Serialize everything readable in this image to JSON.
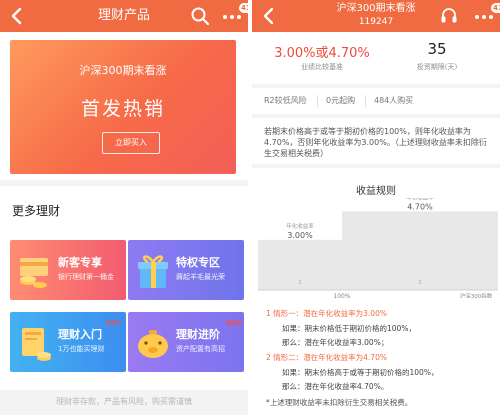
{
  "left": {
    "header": {
      "title": "理财产品",
      "badge": "41"
    },
    "banner": {
      "subtitle": "沪深300期末看涨",
      "headline": "首发热销",
      "button": "立即买入"
    },
    "section_title": "更多理财",
    "cards": [
      {
        "name": "新客专享",
        "desc": "银行理财第一桶金",
        "tag": ""
      },
      {
        "name": "特权专区",
        "desc": "薅起羊毛最光荣",
        "tag": ""
      },
      {
        "name": "理财入门",
        "desc": "1万也能买理财",
        "tag": "HOT"
      },
      {
        "name": "理财进阶",
        "desc": "资产配置有高招",
        "tag": "NEW"
      }
    ],
    "footer": "理财非存款，产品有风险，购买需谨慎"
  },
  "right": {
    "header": {
      "title": "沪深300期末看涨",
      "code": "119247",
      "badge": "41"
    },
    "stats": {
      "rate": "3.00%或4.70%",
      "rate_label": "业绩比较基准",
      "term": "35",
      "term_label": "投资期限(天)"
    },
    "tags": [
      "R2较低风险",
      "0元起购",
      "484人购买"
    ],
    "description": "若期末价格高于或等于期初价格的100%，则年化收益率为4.70%，否则年化收益率为3.00%。（上述理财收益率未扣除衍生交易相关税费）",
    "chart_title": "收益规则",
    "rules": [
      "1  情形一：潜在年化收益率为3.00%",
      "如果：期末价格低于期初价格的100%，",
      "那么：潜在年化收益率3.00%；",
      "2  情形二：潜在年化收益率为4.70%",
      "如果：期末价格高于或等于期初价格的100%，",
      "那么：潜在年化收益率4.70%。",
      "*上述理财收益率未扣除衍生交易相关税费。"
    ]
  },
  "chart_data": {
    "type": "step",
    "title": "收益规则",
    "x_labels": [
      "",
      "100%",
      "沪深300指数"
    ],
    "x_marks": [
      "1",
      "2"
    ],
    "series": [
      {
        "name": "",
        "segments": [
          {
            "label": "年化收益率",
            "value": "3.00%",
            "y": 3.0
          },
          {
            "label": "年化收益率",
            "value": "4.70%",
            "y": 4.7
          }
        ]
      }
    ],
    "colors": {
      "step": "#e8e8e8",
      "label": "#555555"
    }
  },
  "colors": {
    "brand": "#f06b41",
    "rate": "#f04a3c"
  }
}
